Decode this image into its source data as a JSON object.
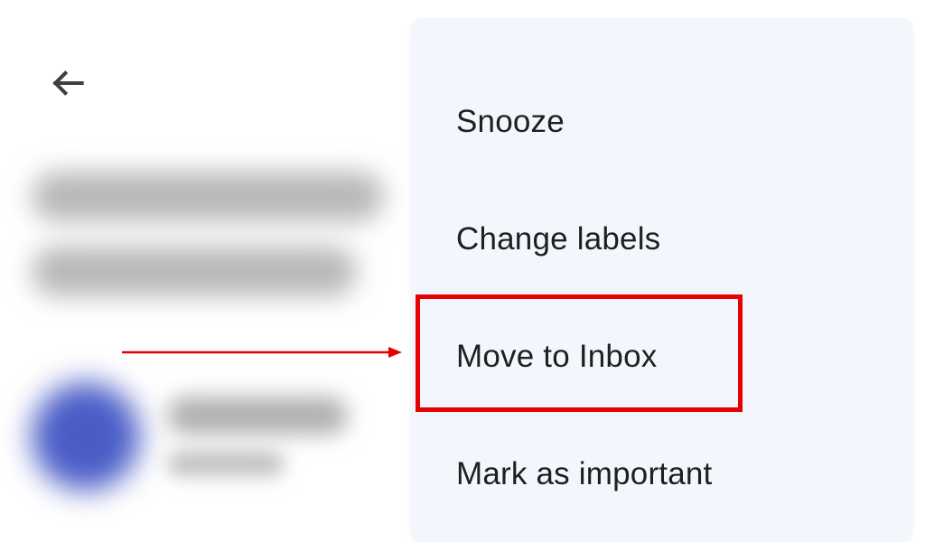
{
  "menu": {
    "items": [
      {
        "label": "Snooze"
      },
      {
        "label": "Change labels"
      },
      {
        "label": "Move to Inbox"
      },
      {
        "label": "Mark as important"
      }
    ]
  }
}
